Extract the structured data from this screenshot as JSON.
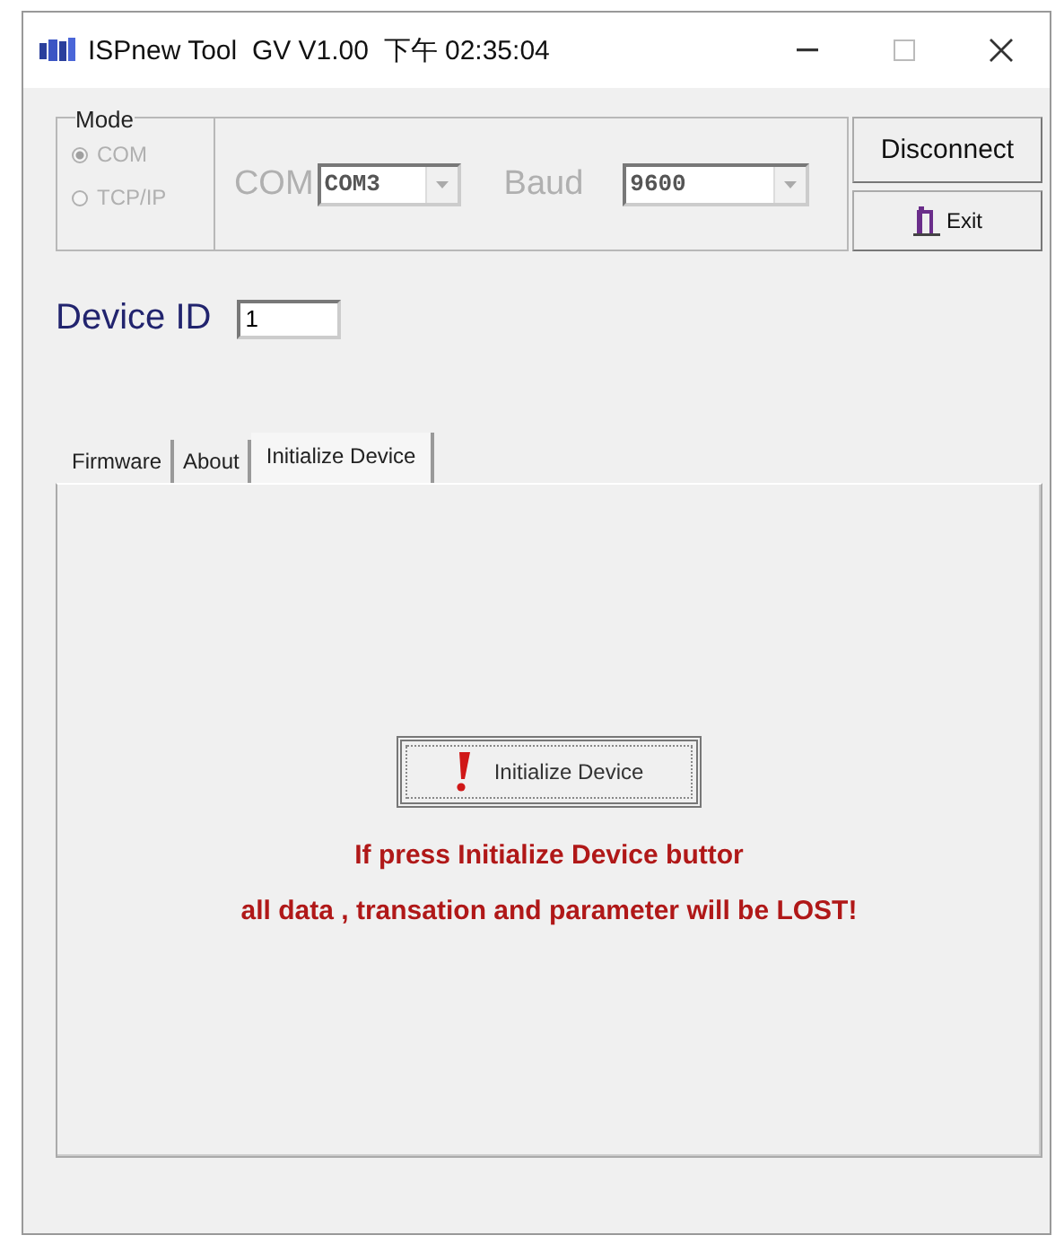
{
  "window": {
    "title": "ISPnew Tool  GV V1.00  下午 02:35:04"
  },
  "mode": {
    "label": "Mode",
    "options": [
      {
        "label": "COM",
        "selected": true,
        "disabled": true
      },
      {
        "label": "TCP/IP",
        "selected": false,
        "disabled": true
      }
    ]
  },
  "connection": {
    "com_label": "COM",
    "com_value": "COM3",
    "baud_label": "Baud",
    "baud_value": "9600",
    "disabled": true
  },
  "buttons": [
    {
      "kind": "disconnect",
      "label": "Disconnect"
    },
    {
      "kind": "exit",
      "label": "Exit"
    }
  ],
  "device_id": {
    "label": "Device ID",
    "value": "1"
  },
  "tabs": [
    {
      "label": "Firmware",
      "selected": false
    },
    {
      "label": "About",
      "selected": false
    },
    {
      "label": "Initialize Device",
      "selected": true
    }
  ],
  "panel": {
    "button": "Initialize Device",
    "warnings": [
      "If press Initialize Device buttor",
      "all data , transation and parameter will be LOST!"
    ]
  }
}
